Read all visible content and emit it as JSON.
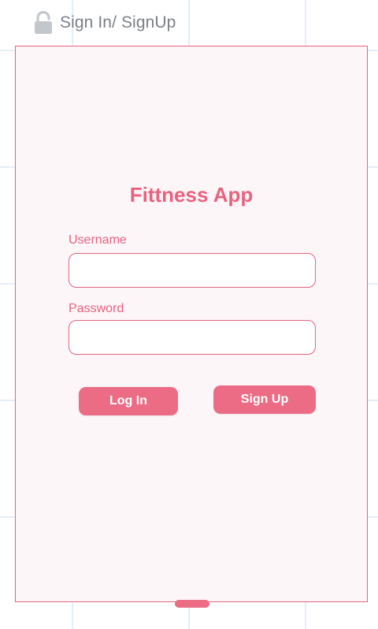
{
  "frame": {
    "label": "Sign In/ SignUp",
    "icon": "lock-icon"
  },
  "form": {
    "title": "Fittness App",
    "username_label": "Username",
    "username_value": "",
    "password_label": "Password",
    "password_value": "",
    "login_label": "Log In",
    "signup_label": "Sign Up"
  },
  "colors": {
    "accent": "#ec6c86",
    "border": "#e5637f",
    "frame_background": "#fcf6f9",
    "grid_line": "#e3eef6",
    "label_gray": "#7b7f86"
  }
}
